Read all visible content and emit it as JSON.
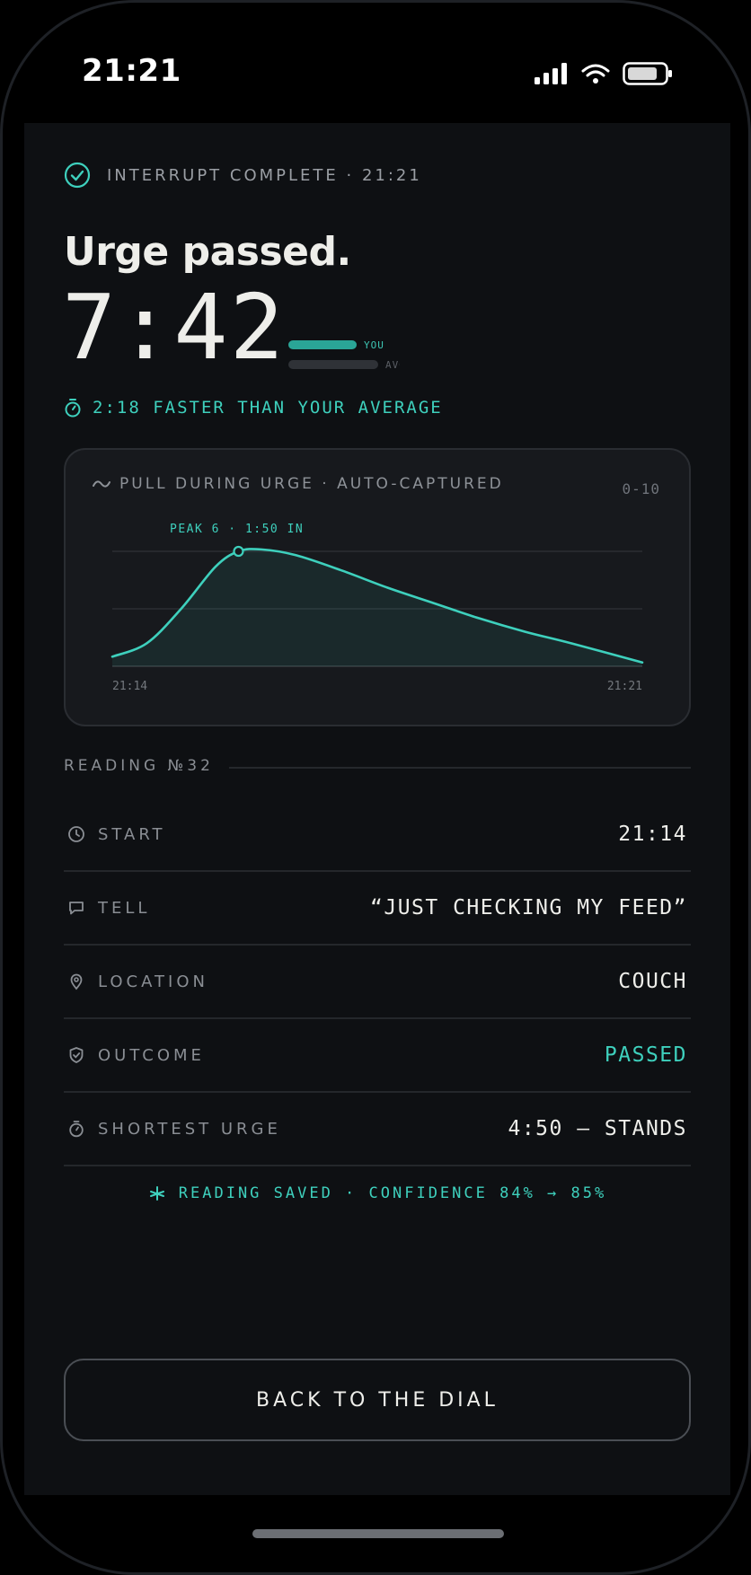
{
  "status_bar": {
    "time": "21:21"
  },
  "header": {
    "topline": "INTERRUPT COMPLETE · 21:21",
    "title": "Urge passed.",
    "duration": "7:42",
    "you_label": "YOU",
    "avg_label": "AVG",
    "comparison": "2:18 FASTER THAN YOUR AVERAGE"
  },
  "chart_card": {
    "title": "PULL DURING URGE · AUTO-CAPTURED",
    "range_label": "0-10",
    "peak_label": "PEAK 6 · 1:50 IN",
    "x_start_label": "21:14",
    "x_end_label": "21:21"
  },
  "chart_data": {
    "type": "area",
    "x": [
      0,
      30,
      60,
      90,
      110,
      130,
      160,
      200,
      240,
      280,
      320,
      360,
      400,
      462
    ],
    "y": [
      0.5,
      1.2,
      3.0,
      5.2,
      6.0,
      6.1,
      5.8,
      5.0,
      4.1,
      3.3,
      2.5,
      1.8,
      1.2,
      0.2
    ],
    "xlabel": "",
    "ylabel": "",
    "x_tick_labels": [
      "21:14",
      "21:21"
    ],
    "ylim": [
      0,
      10
    ],
    "peak": {
      "value": 6,
      "time": "1:50"
    },
    "grid": true,
    "color": "#3ed0bd"
  },
  "reading": {
    "label": "READING №32",
    "rows": [
      {
        "icon": "clock-icon",
        "label": "START",
        "value": "21:14"
      },
      {
        "icon": "speech-bubble-icon",
        "label": "TELL",
        "value": "“JUST CHECKING MY FEED”"
      },
      {
        "icon": "location-pin-icon",
        "label": "LOCATION",
        "value": "COUCH"
      },
      {
        "icon": "shield-check-icon",
        "label": "OUTCOME",
        "value": "PASSED"
      },
      {
        "icon": "stopwatch-icon",
        "label": "SHORTEST URGE",
        "value": "4:50 — STANDS"
      }
    ]
  },
  "saved_text": "READING SAVED · CONFIDENCE 84% → 85%",
  "back_button": "BACK TO THE DIAL",
  "colors": {
    "accent": "#3ed0bd",
    "background": "#0e1013",
    "card": "#17191d"
  }
}
